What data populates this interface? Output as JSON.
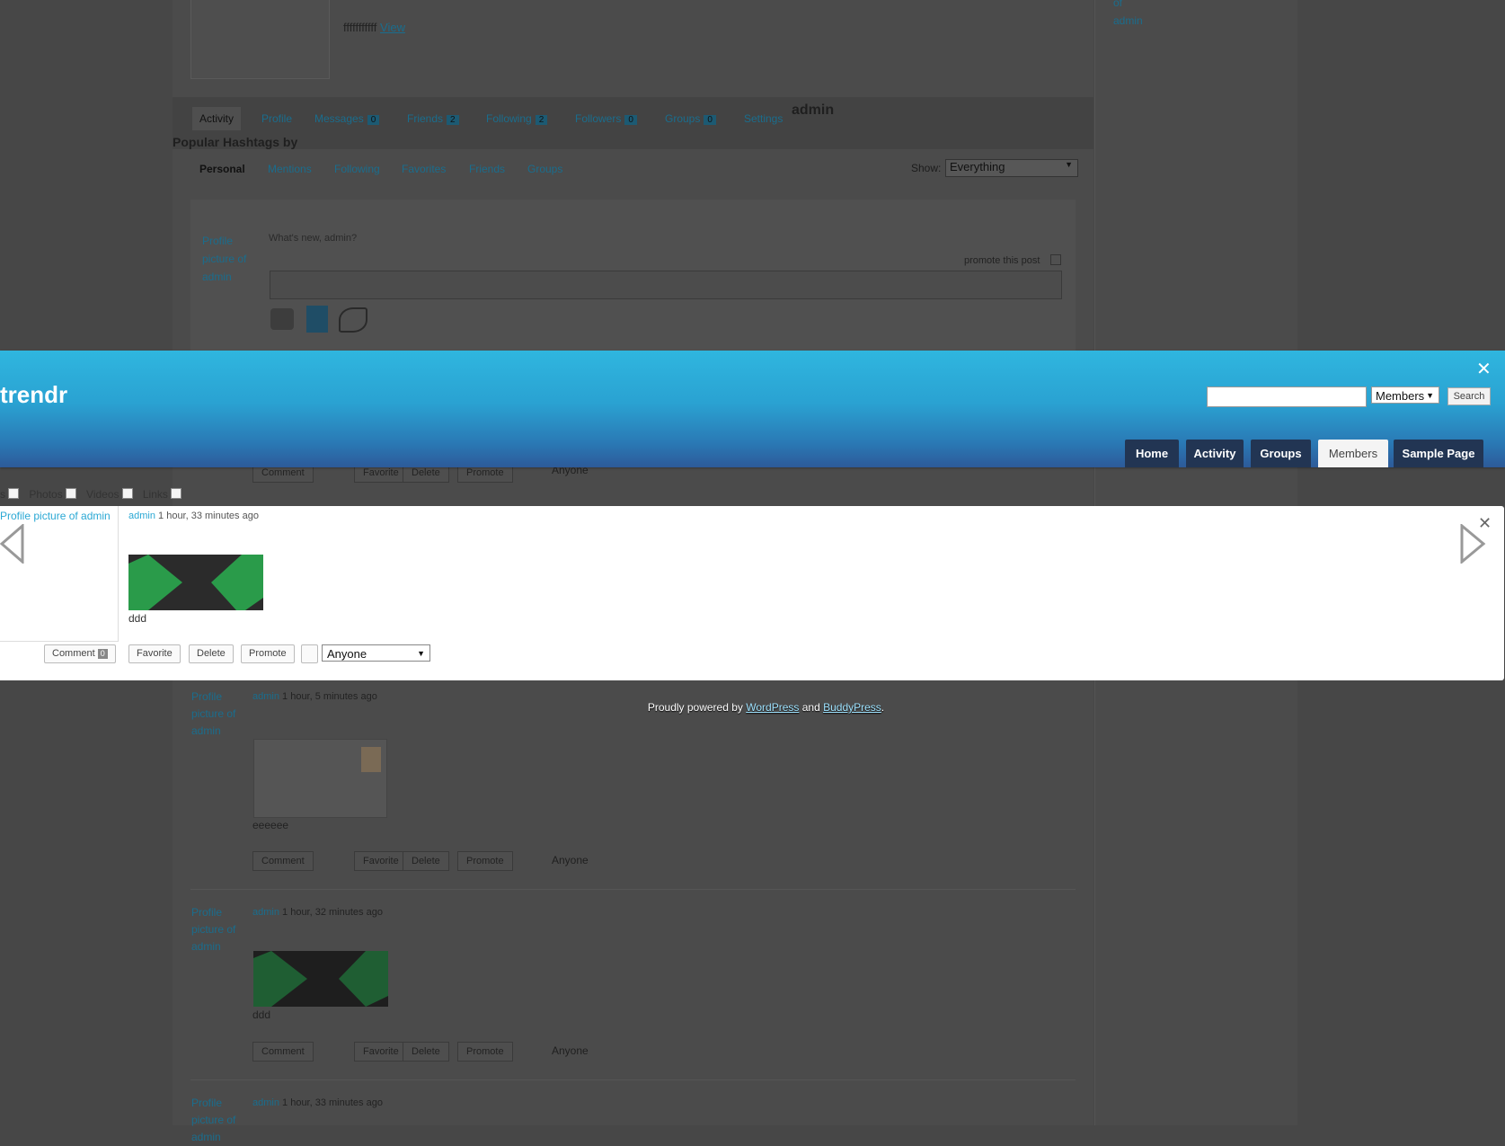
{
  "background": {
    "top_link_text": "fffffffffff",
    "top_link_view": "View",
    "sidebar_links": [
      "of",
      "admin"
    ],
    "profile_tabs": [
      {
        "label": "Activity"
      },
      {
        "label": "Profile"
      },
      {
        "label": "Messages",
        "count": "0"
      },
      {
        "label": "Friends",
        "count": "2"
      },
      {
        "label": "Following",
        "count": "2"
      },
      {
        "label": "Followers",
        "count": "0"
      },
      {
        "label": "Groups",
        "count": "0"
      },
      {
        "label": "Settings"
      }
    ],
    "profile_name": "admin",
    "popular_hashtags": "Popular Hashtags by",
    "sub_tabs": [
      "Personal",
      "Mentions",
      "Following",
      "Favorites",
      "Friends",
      "Groups"
    ],
    "show_label": "Show:",
    "show_value": "Everything",
    "avatar_alt": "Profile picture of admin",
    "whats_new": "What's new, admin?",
    "promote_label": "promote this post",
    "privacy_label": "Anyone",
    "post_buttons": {
      "comment": "Comment",
      "count": "0",
      "favorite": "Favorite",
      "delete": "Delete",
      "promote": "Promote"
    },
    "posts": [
      {
        "author": "admin",
        "time": "1 hour, 5 minutes ago",
        "caption": "eeeeee"
      },
      {
        "author": "admin",
        "time": "1 hour, 32 minutes ago",
        "caption": "ddd"
      },
      {
        "author": "admin",
        "time": "1 hour, 33 minutes ago"
      }
    ]
  },
  "header": {
    "site_title": "trendr",
    "close_symbol": "✕",
    "search_placeholder": "",
    "search_scope": "Members",
    "search_button": "Search",
    "nav": [
      {
        "label": "Home"
      },
      {
        "label": "Activity"
      },
      {
        "label": "Groups"
      },
      {
        "label": "Members",
        "current": true
      },
      {
        "label": "Sample Page"
      }
    ]
  },
  "filters": {
    "items": [
      "s",
      "Photos",
      "Videos",
      "Links"
    ]
  },
  "lightbox": {
    "avatar_alt": "Profile picture of admin",
    "author": "admin",
    "time": "1 hour, 33 minutes ago",
    "caption": "ddd",
    "buttons": {
      "comment": "Comment",
      "comment_count": "0",
      "favorite": "Favorite",
      "delete": "Delete",
      "promote": "Promote"
    },
    "privacy": "Anyone",
    "close_symbol": "✕"
  },
  "footer": {
    "prefix": "Proudly powered by ",
    "wordpress": "WordPress",
    "and": " and ",
    "buddypress": "BuddyPress",
    "suffix": "."
  },
  "colors": {
    "header_top": "#2fb6df",
    "header_bottom": "#2d5a99",
    "nav_bg": "#223553",
    "link": "#2aa8d4",
    "overlay": "#474747"
  }
}
